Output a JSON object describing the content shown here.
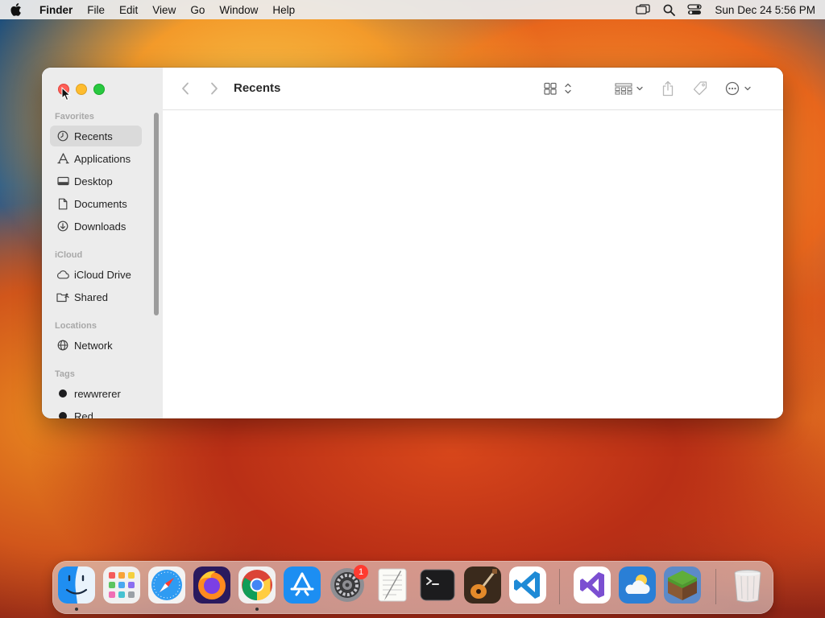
{
  "menubar": {
    "app_name": "Finder",
    "menus": [
      "File",
      "Edit",
      "View",
      "Go",
      "Window",
      "Help"
    ],
    "status_icons": [
      "screen-mirroring-icon",
      "spotlight-search-icon",
      "control-center-icon"
    ],
    "clock": "Sun Dec 24  5:56 PM"
  },
  "window": {
    "title": "Recents",
    "sidebar": {
      "favorites_header": "Favorites",
      "favorites": [
        {
          "label": "Recents",
          "icon": "clock-icon",
          "selected": true
        },
        {
          "label": "Applications",
          "icon": "applications-icon"
        },
        {
          "label": "Desktop",
          "icon": "desktop-icon"
        },
        {
          "label": "Documents",
          "icon": "document-icon"
        },
        {
          "label": "Downloads",
          "icon": "download-icon"
        }
      ],
      "icloud_header": "iCloud",
      "icloud": [
        {
          "label": "iCloud Drive",
          "icon": "cloud-icon"
        },
        {
          "label": "Shared",
          "icon": "shared-folder-icon"
        }
      ],
      "locations_header": "Locations",
      "locations": [
        {
          "label": "Network",
          "icon": "globe-icon"
        }
      ],
      "tags_header": "Tags",
      "tags": [
        {
          "label": "rewwrerer",
          "color": "#1d1d1f"
        },
        {
          "label": "Red",
          "color": "#1d1d1f"
        }
      ]
    },
    "toolbar": {
      "back": "chevron-left-icon",
      "forward": "chevron-right-icon",
      "view_mode": "icon-grid-icon",
      "group": "group-by-icon",
      "share": "share-icon",
      "tag": "tag-icon",
      "more": "ellipsis-circle-icon",
      "search": "search-icon"
    }
  },
  "dock": {
    "apps": [
      "Finder",
      "Launchpad",
      "Safari",
      "Firefox",
      "Google Chrome",
      "App Store",
      "System Settings",
      "TextEdit",
      "Terminal",
      "GarageBand",
      "Visual Studio Code",
      "Visual Studio",
      "Weather",
      "Minecraft",
      "Trash"
    ],
    "system_settings_badge": "1"
  },
  "colors": {
    "close": "#ff5f57",
    "minimize": "#febc2e",
    "zoom": "#28c840"
  }
}
